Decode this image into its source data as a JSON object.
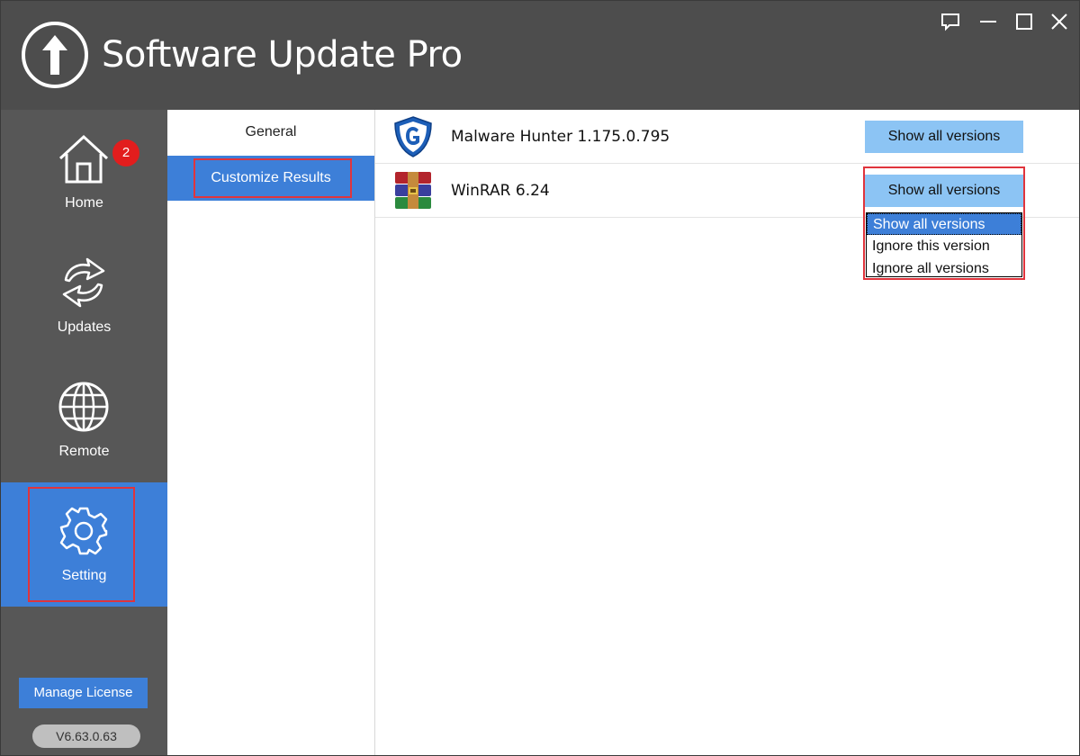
{
  "app": {
    "title": "Software Update Pro"
  },
  "window_controls": [
    "feedback-icon",
    "minimize-icon",
    "maximize-icon",
    "close-icon"
  ],
  "nav": {
    "items": [
      {
        "label": "Home",
        "icon": "home-icon"
      },
      {
        "label": "Updates",
        "icon": "updates-icon",
        "badge": "2"
      },
      {
        "label": "Remote",
        "icon": "globe-icon"
      },
      {
        "label": "Setting",
        "icon": "gear-icon",
        "active": true
      }
    ],
    "manage_license": "Manage License",
    "version": "V6.63.0.63"
  },
  "subnav": {
    "items": [
      {
        "label": "General"
      },
      {
        "label": "Customize Results",
        "active": true
      }
    ]
  },
  "results": [
    {
      "name": "Malware Hunter 1.175.0.795",
      "icon": "malware-hunter-icon",
      "button": "Show all versions"
    },
    {
      "name": "WinRAR 6.24",
      "icon": "winrar-icon",
      "button": "Show all versions"
    }
  ],
  "dropdown": {
    "options": [
      "Show all versions",
      "Ignore this version",
      "Ignore all versions"
    ],
    "selected": "Show all versions"
  },
  "colors": {
    "titlebar": "#4d4d4d",
    "sidebar": "#575757",
    "accent": "#3d7fd8",
    "button": "#8cc4f4",
    "highlight": "#e0343c",
    "badge": "#e21d1d"
  }
}
